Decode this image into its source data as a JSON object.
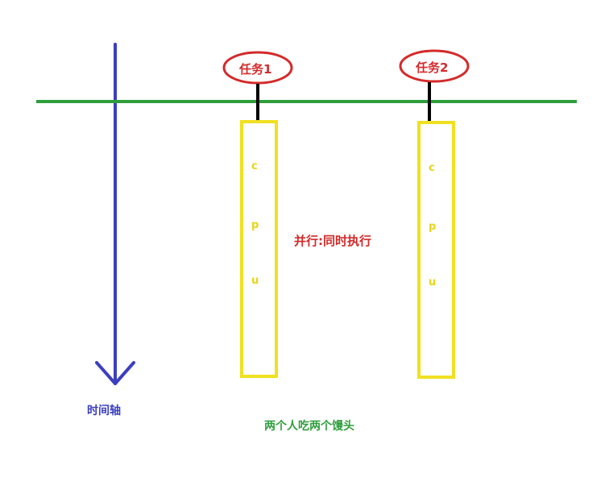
{
  "tasks": [
    {
      "label": "任务1",
      "cpu_letters": [
        "c",
        "p",
        "u"
      ]
    },
    {
      "label": "任务2",
      "cpu_letters": [
        "c",
        "p",
        "u"
      ]
    }
  ],
  "parallel_label": "并行:同时执行",
  "time_axis_label": "时间轴",
  "caption": "两个人吃两个馒头",
  "colors": {
    "time_axis": "#3b3fbf",
    "timeline": "#2e9e3b",
    "task_oval": "#d42a2a",
    "cpu_box": "#f0e020",
    "connector": "#000000"
  }
}
